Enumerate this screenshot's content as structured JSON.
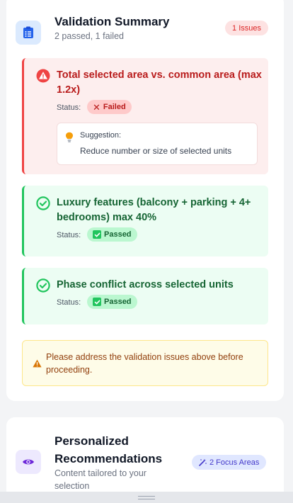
{
  "validation": {
    "title": "Validation Summary",
    "subtitle": "2 passed, 1 failed",
    "issues_badge": "1 Issues",
    "checks": [
      {
        "title": "Total selected area vs. common area (max 1.2x)",
        "status_label": "Status:",
        "status": "Failed",
        "suggestion_label": "Suggestion:",
        "suggestion": "Reduce number or size of selected units"
      },
      {
        "title": "Luxury features (balcony + parking + 4+ bedrooms) max 40%",
        "status_label": "Status:",
        "status": "Passed"
      },
      {
        "title": "Phase conflict across selected units",
        "status_label": "Status:",
        "status": "Passed"
      }
    ],
    "warning": "Please address the validation issues above before proceeding."
  },
  "recommendations": {
    "title_line1": "Personalized",
    "title_line2": "Recommendations",
    "subtitle_line1": "Content tailored to your",
    "subtitle_line2": "selection",
    "focus_badge": "2 Focus Areas"
  },
  "colors": {
    "fail": "#ef4444",
    "pass": "#22c55e",
    "accent_blue": "#2563eb",
    "accent_purple": "#6d28d9"
  },
  "icons": {
    "header": "clipboard-list-icon",
    "fail": "alert-circle-icon",
    "pass": "check-circle-icon",
    "suggestion": "lightbulb-icon",
    "warning": "warning-triangle-icon",
    "recommendations": "eye-icon",
    "focus": "magic-wand-icon"
  }
}
